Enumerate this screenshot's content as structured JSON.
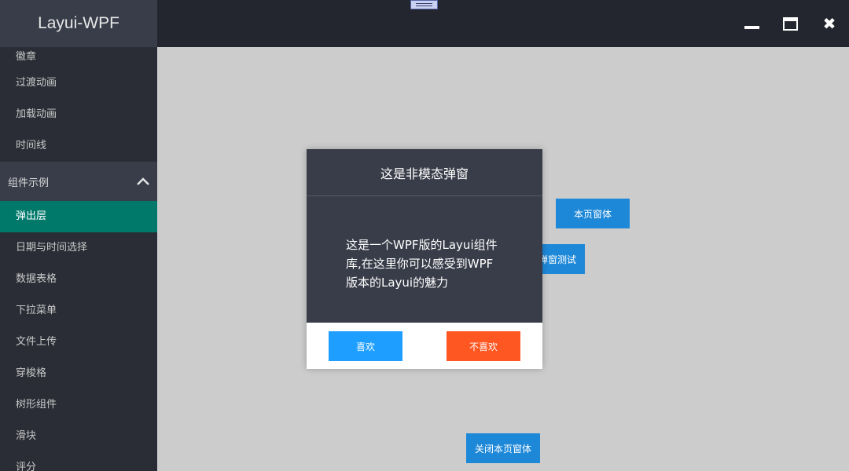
{
  "app": {
    "title": "Layui-WPF"
  },
  "window_controls": {
    "minimize": "minimize-icon",
    "maximize": "maximize-icon",
    "close": "close-icon",
    "close_glyph": "✖"
  },
  "sidebar": {
    "items_before": [
      "徽章",
      "过渡动画",
      "加载动画",
      "时间线"
    ],
    "group": {
      "label": "组件示例",
      "chevron_glyph": "⌃"
    },
    "active_item": "弹出层",
    "items_after": [
      "日期与时间选择",
      "数据表格",
      "下拉菜单",
      "文件上传",
      "穿梭格",
      "树形组件",
      "滑块",
      "评分"
    ]
  },
  "content": {
    "page_window_button": "本页窗体",
    "popup_test_button": "弹窗测试",
    "close_page_window_button": "关闭本页窗体"
  },
  "dialog": {
    "title": "这是非模态弹窗",
    "message": "这是一个WPF版的Layui组件库,在这里你可以感受到WPF版本的Layui的魅力",
    "like_button": "喜欢",
    "dislike_button": "不喜欢"
  },
  "colors": {
    "topbar": "#23262e",
    "sidebar": "#2a2d35",
    "active_item": "#00796b",
    "primary_button": "#1e88d8",
    "like_button": "#1e9fff",
    "dislike_button": "#ff5722"
  }
}
